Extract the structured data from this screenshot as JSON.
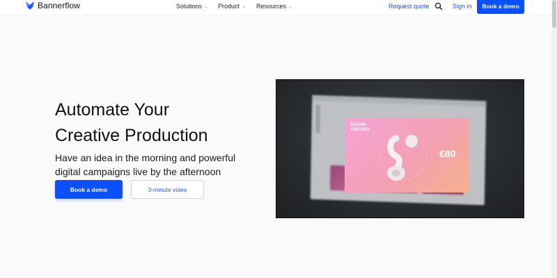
{
  "header": {
    "logo_text": "Bannerflow",
    "nav": [
      {
        "label": "Solutions"
      },
      {
        "label": "Product"
      },
      {
        "label": "Resources"
      }
    ],
    "caret": "⌄",
    "request_quote": "Request quote",
    "sign_in": "Sign in",
    "cta": "Book a demo"
  },
  "hero": {
    "headline_line1": "Automate Your",
    "headline_line2": "Creative Production",
    "subhead_line1": "Have an idea in the morning and powerful",
    "subhead_line2": "digital campaigns live by the afternoon",
    "primary_button": "Book a demo",
    "secondary_button": "3-minute video"
  },
  "video": {
    "ad_brand_line1": "SOUND",
    "ad_brand_line2": "SWEDEN",
    "ad_price": "€80"
  },
  "colors": {
    "brand_blue": "#0a50ff",
    "link_blue": "#1a55ff"
  }
}
